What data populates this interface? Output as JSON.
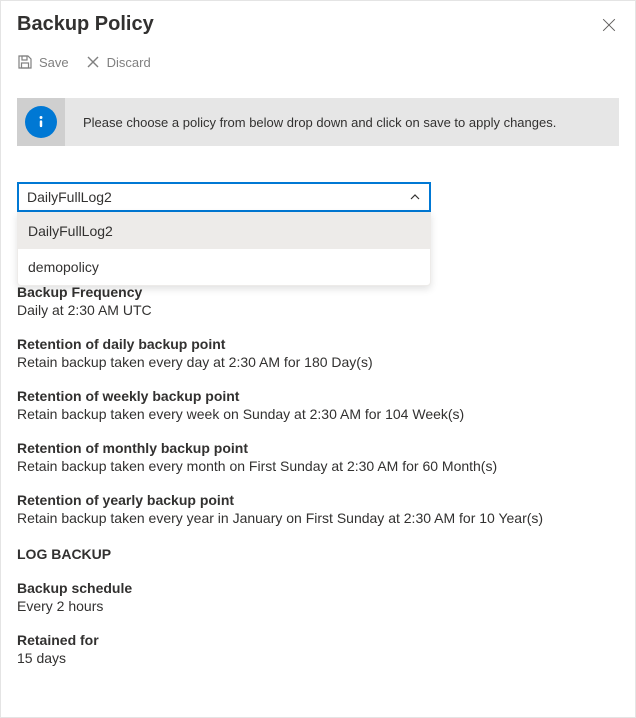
{
  "header": {
    "title": "Backup Policy"
  },
  "toolbar": {
    "save_label": "Save",
    "discard_label": "Discard"
  },
  "info": {
    "message": "Please choose a policy from below drop down and click on save to apply changes."
  },
  "dropdown": {
    "selected": "DailyFullLog2",
    "options": [
      {
        "label": "DailyFullLog2"
      },
      {
        "label": "demopolicy"
      }
    ]
  },
  "sections": {
    "freq_heading": "Backup Frequency",
    "freq_value": "Daily at 2:30 AM UTC",
    "daily_heading": "Retention of daily backup point",
    "daily_value": "Retain backup taken every day at 2:30 AM for 180 Day(s)",
    "weekly_heading": "Retention of weekly backup point",
    "weekly_value": "Retain backup taken every week on Sunday at 2:30 AM for 104 Week(s)",
    "monthly_heading": "Retention of monthly backup point",
    "monthly_value": "Retain backup taken every month on First Sunday at 2:30 AM for 60 Month(s)",
    "yearly_heading": "Retention of yearly backup point",
    "yearly_value": "Retain backup taken every year in January on First Sunday at 2:30 AM for 10 Year(s)",
    "log_heading": "LOG BACKUP",
    "sched_heading": "Backup schedule",
    "sched_value": "Every 2 hours",
    "retained_heading": "Retained for",
    "retained_value": "15 days"
  }
}
